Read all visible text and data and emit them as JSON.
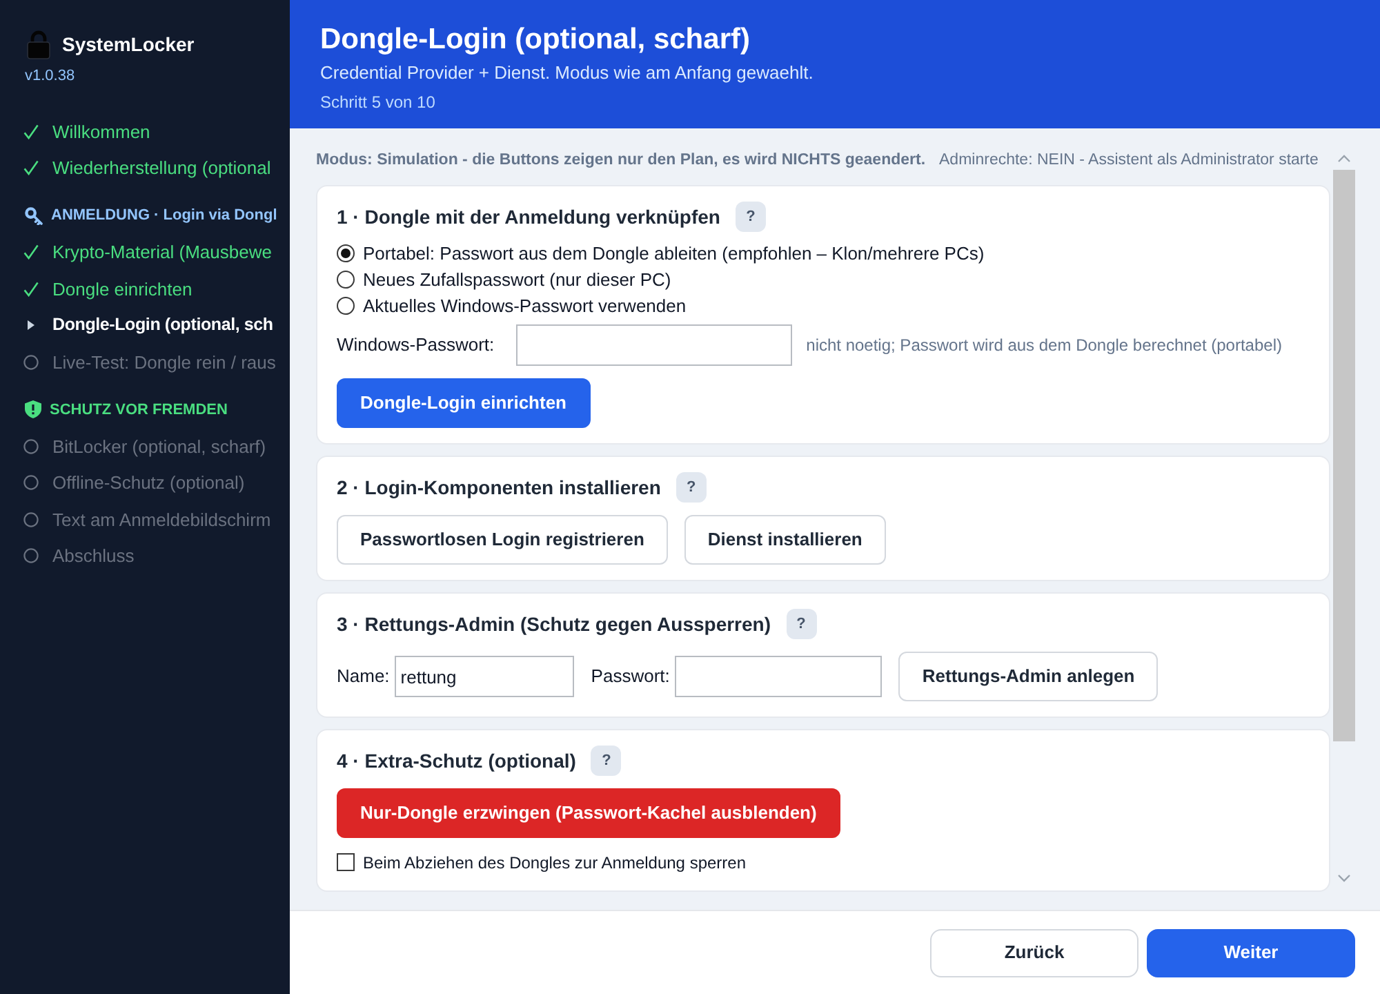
{
  "sidebar": {
    "app_name": "SystemLocker",
    "version": "v1.0.38",
    "items": [
      {
        "kind": "step",
        "label": "Willkommen",
        "done": true,
        "selected": false
      },
      {
        "kind": "step",
        "label": "Wiederherstellung (optional",
        "done": true,
        "selected": false
      },
      {
        "kind": "group",
        "label": "ANMELDUNG · Login via Dongl",
        "color": "#93c5fd"
      },
      {
        "kind": "step",
        "label": "Krypto-Material (Mausbewe",
        "done": true,
        "selected": false
      },
      {
        "kind": "step",
        "label": "Dongle einrichten",
        "done": true,
        "selected": false
      },
      {
        "kind": "step",
        "label": "Dongle-Login (optional, sch",
        "done": false,
        "selected": true
      },
      {
        "kind": "step",
        "label": "Live-Test: Dongle rein / raus",
        "done": false,
        "selected": false
      },
      {
        "kind": "group",
        "label": "SCHUTZ VOR FREMDEN",
        "color": "#4ade80"
      },
      {
        "kind": "step",
        "label": "BitLocker (optional, scharf)",
        "done": false,
        "selected": false
      },
      {
        "kind": "step",
        "label": "Offline-Schutz (optional)",
        "done": false,
        "selected": false
      },
      {
        "kind": "step",
        "label": "Text am Anmeldebildschirm",
        "done": false,
        "selected": false
      },
      {
        "kind": "step",
        "label": "Abschluss",
        "done": false,
        "selected": false
      }
    ]
  },
  "header": {
    "title": "Dongle-Login (optional, scharf)",
    "subtitle": "Credential Provider + Dienst. Modus wie am Anfang gewaehlt.",
    "step": "Schritt 5 von 10"
  },
  "notice": {
    "mode": "Modus: Simulation - die Buttons zeigen nur den Plan, es wird NICHTS geaendert.",
    "admin": "Adminrechte: NEIN - Assistent als Administrator starte"
  },
  "sections": [
    {
      "title": "1 · Dongle mit der Anmeldung verknüpfen",
      "help": "?",
      "rows": [
        {
          "items": [
            {
              "kind": "radio",
              "label": "Portabel: Passwort aus dem Dongle ableiten (empfohlen – Klon/mehrere PCs)",
              "selected": true
            }
          ]
        },
        {
          "items": [
            {
              "kind": "radio",
              "label": "Neues Zufallspasswort (nur dieser PC)",
              "selected": false
            }
          ]
        },
        {
          "items": [
            {
              "kind": "radio",
              "label": "Aktuelles Windows-Passwort verwenden",
              "selected": false
            }
          ]
        },
        {
          "items": [
            {
              "kind": "field",
              "label": "Windows-Passwort:",
              "hint": "nicht noetig; Passwort wird aus dem Dongle berechnet (portabel)"
            }
          ]
        },
        {
          "items": [
            {
              "kind": "primary",
              "label": "Dongle-Login einrichten"
            }
          ]
        }
      ]
    },
    {
      "title": "2 · Login-Komponenten installieren",
      "help": "?",
      "rows": [
        {
          "items": [
            {
              "kind": "secondary",
              "label": "Passwortlosen Login registrieren"
            },
            {
              "kind": "secondary",
              "label": "Dienst installieren"
            }
          ]
        }
      ]
    },
    {
      "title": "3 · Rettungs-Admin (Schutz gegen Aussperren)",
      "help": "?",
      "rows": [
        {
          "items": [
            {
              "kind": "field",
              "label": "Name:",
              "value": "rettung"
            },
            {
              "kind": "field",
              "label": "Passwort:"
            },
            {
              "kind": "secondary",
              "label": "Rettungs-Admin anlegen"
            }
          ]
        }
      ]
    },
    {
      "title": "4 · Extra-Schutz (optional)",
      "help": "?",
      "rows": [
        {
          "items": [
            {
              "kind": "danger",
              "label": "Nur-Dongle erzwingen (Passwort-Kachel ausblenden)"
            }
          ]
        },
        {
          "items": [
            {
              "kind": "checkbox",
              "label": "Beim Abziehen des Dongles zur Anmeldung sperren",
              "checked": false
            }
          ]
        }
      ]
    }
  ],
  "footer": {
    "buttons": [
      {
        "kind": "secondary",
        "label": "Zurück"
      },
      {
        "kind": "primary",
        "label": "Weiter"
      }
    ]
  }
}
